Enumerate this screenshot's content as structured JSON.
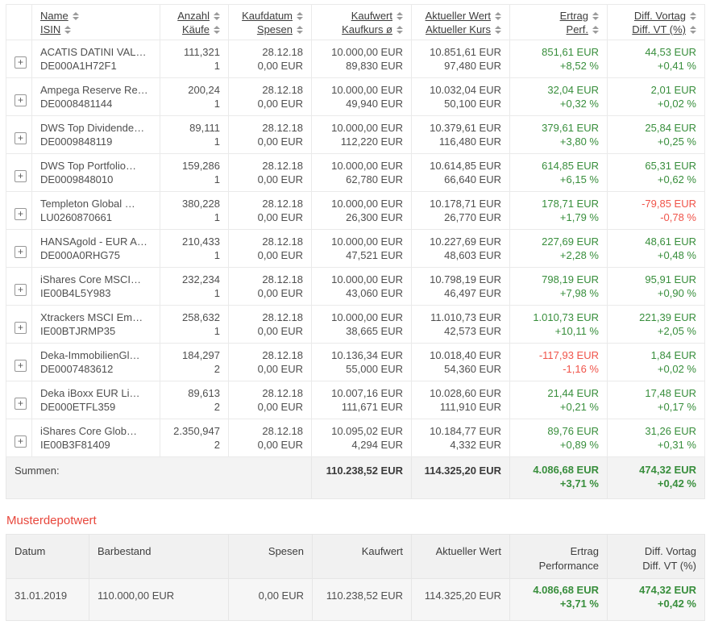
{
  "colors": {
    "positive_green": "#388e3c",
    "negative_red": "#f0544a",
    "section_title_red": "#e8473c",
    "row_highlight_gray": "#f3f3f3"
  },
  "icons": {
    "expand_plus": "+"
  },
  "portfolio_table": {
    "headers": [
      {
        "line1": "Name",
        "line2": "ISIN"
      },
      {
        "line1": "Anzahl",
        "line2": "Käufe"
      },
      {
        "line1": "Kaufdatum",
        "line2": "Spesen"
      },
      {
        "line1": "Kaufwert",
        "line2": "Kaufkurs ø"
      },
      {
        "line1": "Aktueller Wert",
        "line2": "Aktueller Kurs"
      },
      {
        "line1": "Ertrag",
        "line2": "Perf."
      },
      {
        "line1": "Diff. Vortag",
        "line2": "Diff. VT (%)"
      }
    ],
    "rows": [
      {
        "name": "ACATIS DATINI VAL…",
        "isin": "DE000A1H72F1",
        "anzahl": "111,321",
        "kaeufe": "1",
        "kaufdatum": "28.12.18",
        "spesen": "0,00 EUR",
        "kaufwert": "10.000,00 EUR",
        "kaufkurs": "89,830 EUR",
        "aktueller_wert": "10.851,61 EUR",
        "aktueller_kurs": "97,480 EUR",
        "ertrag": "851,61 EUR",
        "perf": "+8,52 %",
        "diff_vortag": "44,53 EUR",
        "diff_vt": "+0,41 %"
      },
      {
        "name": "Ampega Reserve Re…",
        "isin": "DE0008481144",
        "anzahl": "200,24",
        "kaeufe": "1",
        "kaufdatum": "28.12.18",
        "spesen": "0,00 EUR",
        "kaufwert": "10.000,00 EUR",
        "kaufkurs": "49,940 EUR",
        "aktueller_wert": "10.032,04 EUR",
        "aktueller_kurs": "50,100 EUR",
        "ertrag": "32,04 EUR",
        "perf": "+0,32 %",
        "diff_vortag": "2,01 EUR",
        "diff_vt": "+0,02 %"
      },
      {
        "name": "DWS Top Dividende…",
        "isin": "DE0009848119",
        "anzahl": "89,111",
        "kaeufe": "1",
        "kaufdatum": "28.12.18",
        "spesen": "0,00 EUR",
        "kaufwert": "10.000,00 EUR",
        "kaufkurs": "112,220 EUR",
        "aktueller_wert": "10.379,61 EUR",
        "aktueller_kurs": "116,480 EUR",
        "ertrag": "379,61 EUR",
        "perf": "+3,80 %",
        "diff_vortag": "25,84 EUR",
        "diff_vt": "+0,25 %"
      },
      {
        "name": "DWS Top Portfolio…",
        "isin": "DE0009848010",
        "anzahl": "159,286",
        "kaeufe": "1",
        "kaufdatum": "28.12.18",
        "spesen": "0,00 EUR",
        "kaufwert": "10.000,00 EUR",
        "kaufkurs": "62,780 EUR",
        "aktueller_wert": "10.614,85 EUR",
        "aktueller_kurs": "66,640 EUR",
        "ertrag": "614,85 EUR",
        "perf": "+6,15 %",
        "diff_vortag": "65,31 EUR",
        "diff_vt": "+0,62 %"
      },
      {
        "name": "Templeton Global …",
        "isin": "LU0260870661",
        "anzahl": "380,228",
        "kaeufe": "1",
        "kaufdatum": "28.12.18",
        "spesen": "0,00 EUR",
        "kaufwert": "10.000,00 EUR",
        "kaufkurs": "26,300 EUR",
        "aktueller_wert": "10.178,71 EUR",
        "aktueller_kurs": "26,770 EUR",
        "ertrag": "178,71 EUR",
        "perf": "+1,79 %",
        "diff_vortag": "-79,85 EUR",
        "diff_vt": "-0,78 %"
      },
      {
        "name": "HANSAgold - EUR A…",
        "isin": "DE000A0RHG75",
        "anzahl": "210,433",
        "kaeufe": "1",
        "kaufdatum": "28.12.18",
        "spesen": "0,00 EUR",
        "kaufwert": "10.000,00 EUR",
        "kaufkurs": "47,521 EUR",
        "aktueller_wert": "10.227,69 EUR",
        "aktueller_kurs": "48,603 EUR",
        "ertrag": "227,69 EUR",
        "perf": "+2,28 %",
        "diff_vortag": "48,61 EUR",
        "diff_vt": "+0,48 %"
      },
      {
        "name": "iShares Core MSCI…",
        "isin": "IE00B4L5Y983",
        "anzahl": "232,234",
        "kaeufe": "1",
        "kaufdatum": "28.12.18",
        "spesen": "0,00 EUR",
        "kaufwert": "10.000,00 EUR",
        "kaufkurs": "43,060 EUR",
        "aktueller_wert": "10.798,19 EUR",
        "aktueller_kurs": "46,497 EUR",
        "ertrag": "798,19 EUR",
        "perf": "+7,98 %",
        "diff_vortag": "95,91 EUR",
        "diff_vt": "+0,90 %"
      },
      {
        "name": "Xtrackers MSCI Em…",
        "isin": "IE00BTJRMP35",
        "anzahl": "258,632",
        "kaeufe": "1",
        "kaufdatum": "28.12.18",
        "spesen": "0,00 EUR",
        "kaufwert": "10.000,00 EUR",
        "kaufkurs": "38,665 EUR",
        "aktueller_wert": "11.010,73 EUR",
        "aktueller_kurs": "42,573 EUR",
        "ertrag": "1.010,73 EUR",
        "perf": "+10,11 %",
        "diff_vortag": "221,39 EUR",
        "diff_vt": "+2,05 %"
      },
      {
        "name": "Deka-ImmobilienGl…",
        "isin": "DE0007483612",
        "anzahl": "184,297",
        "kaeufe": "2",
        "kaufdatum": "28.12.18",
        "spesen": "0,00 EUR",
        "kaufwert": "10.136,34 EUR",
        "kaufkurs": "55,000 EUR",
        "aktueller_wert": "10.018,40 EUR",
        "aktueller_kurs": "54,360 EUR",
        "ertrag": "-117,93 EUR",
        "perf": "-1,16 %",
        "diff_vortag": "1,84 EUR",
        "diff_vt": "+0,02 %"
      },
      {
        "name": "Deka iBoxx EUR Li…",
        "isin": "DE000ETFL359",
        "anzahl": "89,613",
        "kaeufe": "2",
        "kaufdatum": "28.12.18",
        "spesen": "0,00 EUR",
        "kaufwert": "10.007,16 EUR",
        "kaufkurs": "111,671 EUR",
        "aktueller_wert": "10.028,60 EUR",
        "aktueller_kurs": "111,910 EUR",
        "ertrag": "21,44 EUR",
        "perf": "+0,21 %",
        "diff_vortag": "17,48 EUR",
        "diff_vt": "+0,17 %"
      },
      {
        "name": "iShares Core Glob…",
        "isin": "IE00B3F81409",
        "anzahl": "2.350,947",
        "kaeufe": "2",
        "kaufdatum": "28.12.18",
        "spesen": "0,00 EUR",
        "kaufwert": "10.095,02 EUR",
        "kaufkurs": "4,294 EUR",
        "aktueller_wert": "10.184,77 EUR",
        "aktueller_kurs": "4,332 EUR",
        "ertrag": "89,76 EUR",
        "perf": "+0,89 %",
        "diff_vortag": "31,26 EUR",
        "diff_vt": "+0,31 %"
      }
    ],
    "totals": {
      "label": "Summen:",
      "kaufwert": "110.238,52 EUR",
      "aktueller_wert": "114.325,20 EUR",
      "ertrag": "4.086,68 EUR",
      "perf": "+3,71 %",
      "diff_vortag": "474,32 EUR",
      "diff_vt": "+0,42 %"
    }
  },
  "depot_value": {
    "title": "Musterdepotwert",
    "headers": [
      {
        "line1": "Datum",
        "line2": ""
      },
      {
        "line1": "Barbestand",
        "line2": ""
      },
      {
        "line1": "Spesen",
        "line2": ""
      },
      {
        "line1": "Kaufwert",
        "line2": ""
      },
      {
        "line1": "Aktueller Wert",
        "line2": ""
      },
      {
        "line1": "Ertrag",
        "line2": "Performance"
      },
      {
        "line1": "Diff. Vortag",
        "line2": "Diff. VT (%)"
      }
    ],
    "row": {
      "datum": "31.01.2019",
      "barbestand": "110.000,00 EUR",
      "spesen": "0,00 EUR",
      "kaufwert": "110.238,52 EUR",
      "aktueller_wert": "114.325,20 EUR",
      "ertrag": "4.086,68 EUR",
      "performance": "+3,71 %",
      "diff_vortag": "474,32 EUR",
      "diff_vt": "+0,42 %"
    }
  }
}
